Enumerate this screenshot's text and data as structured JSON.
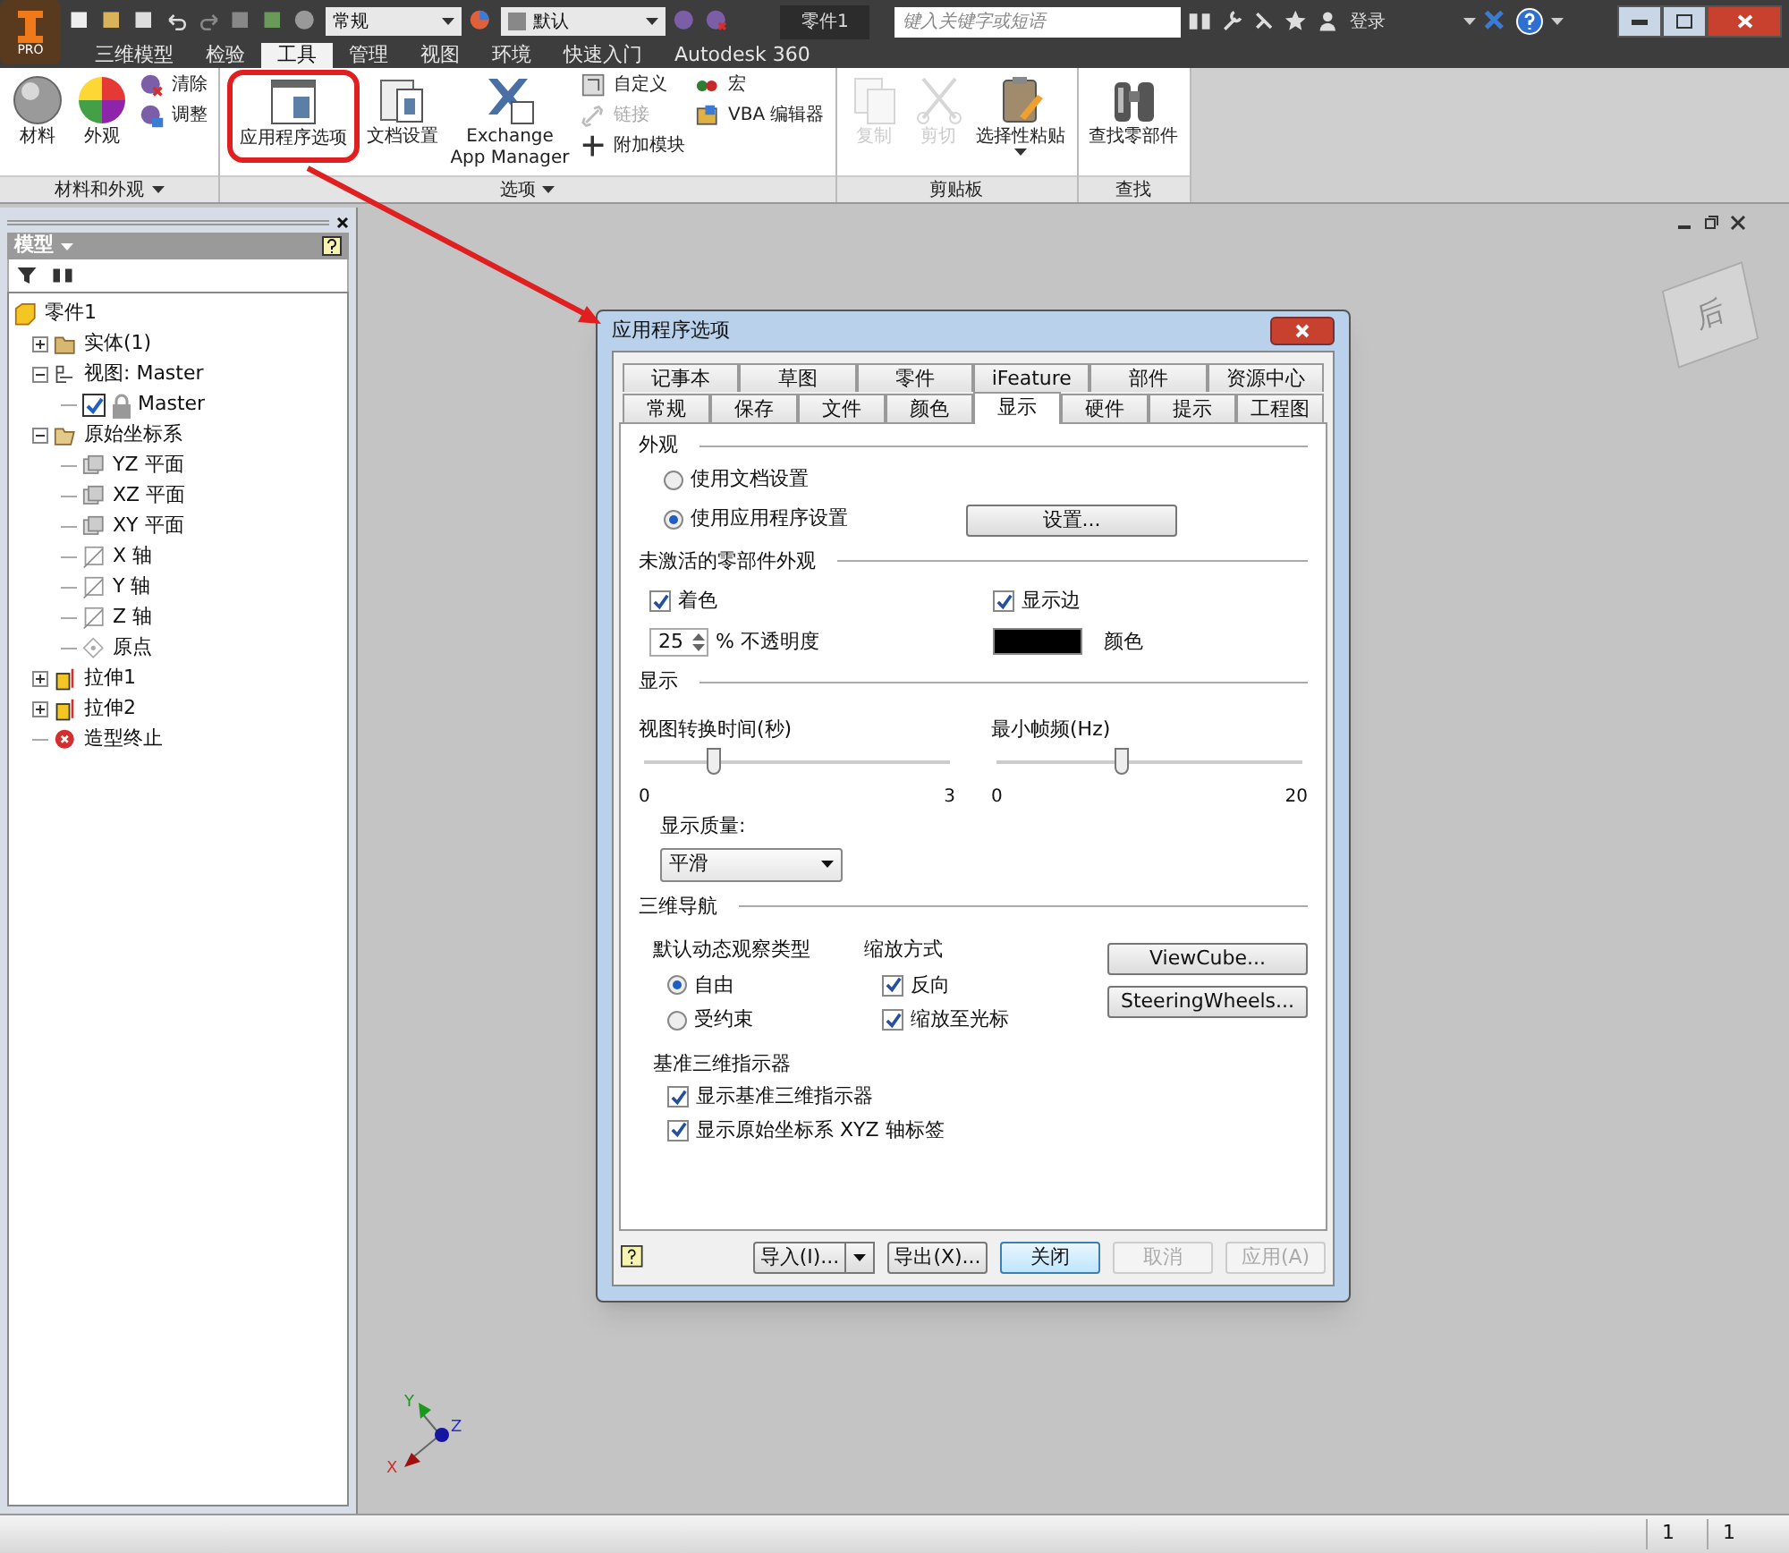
{
  "title_bar": {
    "logo_badge": "PRO",
    "quick_style": "常规",
    "appearance": "默认",
    "document_title": "零件1",
    "search": {
      "placeholder": "键入关键字或短语"
    },
    "sign_in": "登录"
  },
  "menu_tabs": [
    {
      "label": "三维模型",
      "selected": false
    },
    {
      "label": "检验",
      "selected": false
    },
    {
      "label": "工具",
      "selected": true
    },
    {
      "label": "管理",
      "selected": false
    },
    {
      "label": "视图",
      "selected": false
    },
    {
      "label": "环境",
      "selected": false
    },
    {
      "label": "快速入门",
      "selected": false
    },
    {
      "label": "Autodesk 360",
      "selected": false
    }
  ],
  "ribbon": [
    {
      "label": "材料和外观",
      "menu": true,
      "items": [
        {
          "kind": "large",
          "label": "材料",
          "disabled": false
        },
        {
          "kind": "large",
          "label": "外观",
          "disabled": false
        },
        {
          "kind": "stack",
          "tools": [
            {
              "label": "清除",
              "disabled": false
            },
            {
              "label": "调整",
              "disabled": false
            }
          ]
        }
      ]
    },
    {
      "label": "选项",
      "menu": true,
      "items": [
        {
          "kind": "large",
          "label": "应用程序选项",
          "disabled": false
        },
        {
          "kind": "large",
          "label": "文档设置",
          "disabled": false
        },
        {
          "kind": "large",
          "label": "Exchange App Manager",
          "disabled": false
        },
        {
          "kind": "stack",
          "tools": [
            {
              "label": "自定义",
              "disabled": false
            },
            {
              "label": "链接",
              "disabled": true
            },
            {
              "label": "附加模块",
              "disabled": false
            }
          ]
        },
        {
          "kind": "stack",
          "tools": [
            {
              "label": "宏",
              "disabled": false
            },
            {
              "label": "VBA 编辑器",
              "disabled": false
            }
          ]
        }
      ]
    },
    {
      "label": "剪贴板",
      "menu": false,
      "items": [
        {
          "kind": "large",
          "label": "复制",
          "disabled": true
        },
        {
          "kind": "large",
          "label": "剪切",
          "disabled": true
        },
        {
          "kind": "large",
          "label": "选择性粘贴",
          "disabled": false,
          "dropdown": true
        }
      ]
    },
    {
      "label": "查找",
      "menu": false,
      "items": [
        {
          "kind": "large",
          "label": "查找零部件",
          "disabled": false
        }
      ]
    }
  ],
  "browser": {
    "title": "模型",
    "tree": [
      {
        "label": "零件1",
        "kind": "part",
        "children": [
          {
            "label": "实体(1)",
            "kind": "folder",
            "expanded": false
          },
          {
            "label": "视图: Master",
            "kind": "view",
            "expanded": true,
            "children": [
              {
                "label": "Master",
                "kind": "representation",
                "checked": true
              }
            ]
          },
          {
            "label": "原始坐标系",
            "kind": "origin",
            "expanded": true,
            "children": [
              {
                "label": "YZ 平面",
                "kind": "plane"
              },
              {
                "label": "XZ 平面",
                "kind": "plane"
              },
              {
                "label": "XY 平面",
                "kind": "plane"
              },
              {
                "label": "X 轴",
                "kind": "axis"
              },
              {
                "label": "Y 轴",
                "kind": "axis"
              },
              {
                "label": "Z 轴",
                "kind": "axis"
              },
              {
                "label": "原点",
                "kind": "point"
              }
            ]
          },
          {
            "label": "拉伸1",
            "kind": "extrude",
            "expanded": false
          },
          {
            "label": "拉伸2",
            "kind": "extrude",
            "expanded": false
          },
          {
            "label": "造型终止",
            "kind": "end"
          }
        ]
      }
    ]
  },
  "viewport": {
    "viewcube_face": "后",
    "axis_labels": [
      "X",
      "Y",
      "Z"
    ]
  },
  "dialog": {
    "title": "应用程序选项",
    "tabs_back": [
      {
        "label": "记事本",
        "selected": false
      },
      {
        "label": "草图",
        "selected": false
      },
      {
        "label": "零件",
        "selected": false
      },
      {
        "label": "iFeature",
        "selected": false
      },
      {
        "label": "部件",
        "selected": false
      },
      {
        "label": "资源中心",
        "selected": false
      }
    ],
    "tabs_front": [
      {
        "label": "常规",
        "selected": false
      },
      {
        "label": "保存",
        "selected": false
      },
      {
        "label": "文件",
        "selected": false
      },
      {
        "label": "颜色",
        "selected": false
      },
      {
        "label": "显示",
        "selected": true
      },
      {
        "label": "硬件",
        "selected": false
      },
      {
        "label": "提示",
        "selected": false
      },
      {
        "label": "工程图",
        "selected": false
      }
    ],
    "appearance": {
      "heading": "外观",
      "options": [
        {
          "label": "使用文档设置",
          "selected": false
        },
        {
          "label": "使用应用程序设置",
          "selected": true
        }
      ],
      "settings_button": "设置..."
    },
    "inactive": {
      "heading": "未激活的零部件外观",
      "shading": {
        "label": "着色",
        "checked": true
      },
      "opacity": {
        "value": "25",
        "unit": "% 不透明度"
      },
      "show_edges": {
        "label": "显示边",
        "checked": true
      },
      "edge_color": {
        "color": "#000000",
        "label": "颜色"
      }
    },
    "display": {
      "heading": "显示",
      "sliders": [
        {
          "label": "视图转换时间(秒)",
          "level": 0.23,
          "min": "0",
          "max": "3"
        },
        {
          "label": "最小帧频(Hz)",
          "level": 0.41,
          "min": "0",
          "max": "20"
        }
      ],
      "quality": {
        "label": "显示质量:",
        "value": "平滑"
      }
    },
    "navigation": {
      "heading": "三维导航",
      "orbit": {
        "label": "默认动态观察类型",
        "options": [
          {
            "label": "自由",
            "selected": true
          },
          {
            "label": "受约束",
            "selected": false
          }
        ]
      },
      "zoom": {
        "label": "缩放方式",
        "options": [
          {
            "label": "反向",
            "checked": true
          },
          {
            "label": "缩放至光标",
            "checked": true
          }
        ]
      },
      "buttons": [
        "ViewCube...",
        "SteeringWheels..."
      ]
    },
    "triad": {
      "label": "基准三维指示器",
      "options": [
        {
          "label": "显示基准三维指示器",
          "checked": true
        },
        {
          "label": "显示原始坐标系 XYZ 轴标签",
          "checked": true
        }
      ]
    },
    "footer": [
      {
        "label": "导入(I)...",
        "kind": "split",
        "disabled": false
      },
      {
        "label": "导出(X)...",
        "kind": "plain",
        "disabled": false
      },
      {
        "label": "关闭",
        "kind": "default",
        "disabled": false
      },
      {
        "label": "取消",
        "kind": "plain",
        "disabled": true
      },
      {
        "label": "应用(A)",
        "kind": "plain",
        "disabled": true
      }
    ]
  },
  "status_bar": [
    "1",
    "1"
  ]
}
